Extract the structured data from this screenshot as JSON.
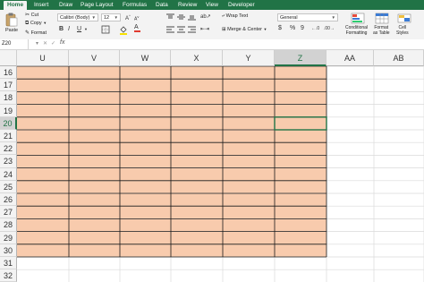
{
  "tabs": [
    "Home",
    "Insert",
    "Draw",
    "Page Layout",
    "Formulas",
    "Data",
    "Review",
    "View",
    "Developer"
  ],
  "ribbon": {
    "paste": "Paste",
    "cut": "Cut",
    "copy": "Copy",
    "format": "Format",
    "font_name": "Calibri (Body)",
    "font_size": "12",
    "wrap_text": "Wrap Text",
    "merge_center": "Merge & Center",
    "number_format": "General",
    "conditional_formatting_1": "Conditional",
    "conditional_formatting_2": "Formatting",
    "format_as_table_1": "Format",
    "format_as_table_2": "as Table",
    "cell_styles_1": "Cell",
    "cell_styles_2": "Styles",
    "currency": "$",
    "percent": "%",
    "comma": "9",
    "font_color": "#e03a2f"
  },
  "formula_bar": {
    "name_box": "Z20",
    "fx": "fx",
    "value": ""
  },
  "columns": [
    "U",
    "V",
    "W",
    "X",
    "Y",
    "Z",
    "AA",
    "AB"
  ],
  "rows": [
    "16",
    "17",
    "18",
    "19",
    "20",
    "21",
    "22",
    "23",
    "24",
    "25",
    "26",
    "27",
    "28",
    "29",
    "30",
    "31",
    "32"
  ],
  "selected_cell": "Z20",
  "colors": {
    "fill": "#f8cbad",
    "excel_green": "#217346",
    "header_bg": "#f3f3f3"
  }
}
